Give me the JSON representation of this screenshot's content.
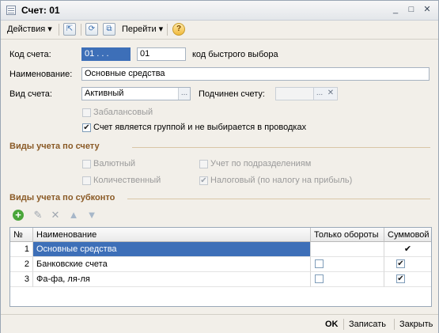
{
  "window": {
    "title": "Счет: 01"
  },
  "toolbar": {
    "actions_label": "Действия",
    "goto_label": "Перейти",
    "help_label": "?"
  },
  "form": {
    "code_label": "Код счета:",
    "code_value": "01 . . .",
    "quick_code_value": "01",
    "quick_code_label": "код быстрого выбора",
    "name_label": "Наименование:",
    "name_value": "Основные средства",
    "type_label": "Вид счета:",
    "type_value": "Активный",
    "parent_label": "Подчинен счету:",
    "parent_value": "",
    "offbalance_label": "Забалансовый",
    "offbalance_checked": false,
    "group_label": "Счет является группой и не выбирается в проводках",
    "group_checked": true
  },
  "accounting_types": {
    "title": "Виды учета по счету",
    "currency_label": "Валютный",
    "quantity_label": "Количественный",
    "divisions_label": "Учет по подразделениям",
    "tax_label": "Налоговый (по налогу на прибыль)",
    "tax_checked": true
  },
  "subconto": {
    "title": "Виды учета по субконто",
    "columns": {
      "num": "№",
      "name": "Наименование",
      "turnover": "Только обороты",
      "sum": "Суммовой"
    },
    "rows": [
      {
        "num": "1",
        "name": "Основные средства",
        "turnover": "",
        "sum": "✔"
      },
      {
        "num": "2",
        "name": "Банковские счета",
        "turnover": "",
        "sum": "✔"
      },
      {
        "num": "3",
        "name": "Фа-фа, ля-ля",
        "turnover": "",
        "sum": "✔"
      }
    ]
  },
  "footer": {
    "ok_label": "OK",
    "save_label": "Записать",
    "close_label": "Закрыть"
  },
  "icons": {
    "check": "✔",
    "dots": "...",
    "clear": "✕",
    "add": "+",
    "delete": "✕",
    "up": "▲",
    "down": "▼",
    "pencil": "✎",
    "dropdown": "▾"
  }
}
